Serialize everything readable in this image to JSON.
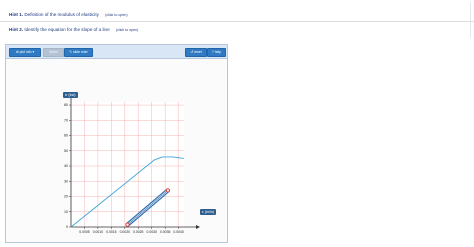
{
  "hints": [
    {
      "num": "Hint 1.",
      "text": "Definition of the modulus of elasticity",
      "open": "(click to open)"
    },
    {
      "num": "Hint 2.",
      "text": "Identify the equation for the slope of a line",
      "open": "(click to open)"
    }
  ],
  "toolbar": {
    "plot_info": "plot info",
    "delete": "delete",
    "slide_ruler": "slide ruler",
    "reset": "reset",
    "help": "help",
    "plot_info_icon": "plus-icon",
    "slide_ruler_icon": "pencil-icon",
    "reset_icon": "reset-icon"
  },
  "graph": {
    "y_axis_tag": "σ (ksi)",
    "x_axis_tag": "ε (in/in)",
    "y_ticks": [
      "80",
      "70",
      "60",
      "50",
      "40",
      "30",
      "20",
      "10",
      "0"
    ],
    "x_ticks": [
      "0.0005",
      "0.0010",
      "0.0015",
      "0.0020",
      "0.0025",
      "0.0030",
      "0.0035",
      "0.0040"
    ]
  },
  "chart_data": {
    "type": "line",
    "x_range": [
      0,
      0.0042
    ],
    "y_range": [
      0,
      82
    ],
    "grid": true,
    "series": [
      {
        "values": [
          [
            0,
            0
          ],
          [
            0.0031,
            44
          ],
          [
            0.0034,
            46
          ],
          [
            0.0038,
            46
          ],
          [
            0.0042,
            45
          ]
        ],
        "color": "#3aa5d8"
      }
    ],
    "ruler": {
      "start": [
        0.0021,
        1.5
      ],
      "end": [
        0.0036,
        24
      ],
      "color": "#2f6fb0",
      "handle_color": "#e0382e"
    }
  },
  "colors": {
    "grid": "#f4b6b6",
    "axis": "#333333",
    "hint_text": "#1f3b82",
    "button_blue": "#2f7ac2"
  }
}
